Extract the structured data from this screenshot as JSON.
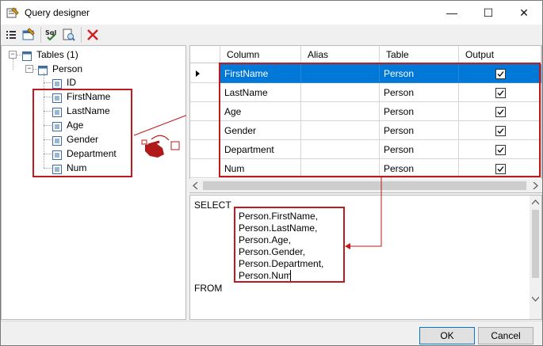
{
  "window": {
    "title": "Query designer"
  },
  "titlebar_buttons": {
    "minimize": "—",
    "maximize": "☐",
    "close": "✕"
  },
  "toolbar": {
    "icons": [
      "list-icon",
      "table-icon",
      "sql-icon",
      "preview-icon",
      "delete-icon"
    ]
  },
  "tree": {
    "root": "Tables (1)",
    "table": "Person",
    "columns": [
      "ID",
      "FirstName",
      "LastName",
      "Age",
      "Gender",
      "Department",
      "Num"
    ]
  },
  "grid": {
    "headers": [
      "Column",
      "Alias",
      "Table",
      "Output"
    ],
    "rows": [
      {
        "column": "FirstName",
        "alias": "",
        "table": "Person",
        "output": true
      },
      {
        "column": "LastName",
        "alias": "",
        "table": "Person",
        "output": true
      },
      {
        "column": "Age",
        "alias": "",
        "table": "Person",
        "output": true
      },
      {
        "column": "Gender",
        "alias": "",
        "table": "Person",
        "output": true
      },
      {
        "column": "Department",
        "alias": "",
        "table": "Person",
        "output": true
      },
      {
        "column": "Num",
        "alias": "",
        "table": "Person",
        "output": true
      }
    ],
    "selected_row": 0
  },
  "sql": {
    "select": "SELECT",
    "fields": [
      "Person.FirstName,",
      "Person.LastName,",
      "Person.Age,",
      "Person.Gender,",
      "Person.Department,",
      "Person.Num"
    ],
    "from": "FROM"
  },
  "buttons": {
    "ok": "OK",
    "cancel": "Cancel"
  },
  "colors": {
    "accent": "#0078d7",
    "highlight": "#c0191e"
  }
}
